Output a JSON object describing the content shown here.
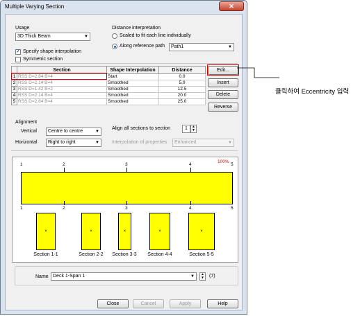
{
  "window": {
    "title": "Multiple Varying Section",
    "close_glyph": "✕"
  },
  "usage": {
    "label": "Usage",
    "value": "3D Thick Beam"
  },
  "specify_shape": {
    "label": "Specify shape interpolation",
    "checked": true,
    "glyph": "✓"
  },
  "symmetric": {
    "label": "Symmetric section",
    "checked": false
  },
  "distance": {
    "label": "Distance interpretation",
    "scaled_label": "Scaled to fit each line individually",
    "along_label": "Along reference path",
    "path_value": "Path1"
  },
  "table": {
    "headers": [
      "Section",
      "Shape Interpolation",
      "Distance"
    ],
    "rows": [
      {
        "num": "1",
        "section": "RSS D=2.84 B=4",
        "interp": "Start",
        "distance": "0.0"
      },
      {
        "num": "2",
        "section": "RSS D=2.14 B=4",
        "interp": "Smoothed",
        "distance": "5.0"
      },
      {
        "num": "3",
        "section": "RSS D=1.42 B=2",
        "interp": "Smoothed",
        "distance": "12.5"
      },
      {
        "num": "4",
        "section": "RSS D=2.14 B=4",
        "interp": "Smoothed",
        "distance": "20.0"
      },
      {
        "num": "5",
        "section": "RSS D=2.84 B=4",
        "interp": "Smoothed",
        "distance": "25.0"
      }
    ]
  },
  "side_buttons": {
    "edit": "Edit...",
    "insert": "Insert",
    "delete": "Delete",
    "reverse": "Reverse"
  },
  "alignment": {
    "label": "Alignment",
    "vertical_label": "Vertical",
    "vertical_value": "Centre to centre",
    "horizontal_label": "Horizontal",
    "horizontal_value": "Right to right",
    "align_all_label": "Align all sections to section",
    "align_all_value": "1",
    "interp_props_label": "Interpolation of properties",
    "interp_props_value": "Enhanced"
  },
  "preview": {
    "percent": "100%",
    "top_ticks": [
      "1",
      "2",
      "3",
      "4",
      "5"
    ],
    "bottom_ticks": [
      "1",
      "2",
      "3",
      "4",
      "5"
    ],
    "cg_glyph": "×",
    "sections": [
      "Section 1-1",
      "Section 2-2",
      "Section 3-3",
      "Section 4-4",
      "Section 5-5"
    ]
  },
  "name": {
    "label": "Name",
    "value": "Deck 1-Span 1",
    "count": "(7)"
  },
  "footer": {
    "close": "Close",
    "cancel": "Cancel",
    "apply": "Apply",
    "help": "Help"
  },
  "annotation": {
    "text": "클릭하여 Eccentricity 입력"
  },
  "glyphs": {
    "dropdown": "▼",
    "spin_up": "▲",
    "spin_down": "▼"
  },
  "colors": {
    "section_fill": "#ffff00",
    "highlight": "#d00000",
    "preview_bg": "#ffffff"
  }
}
